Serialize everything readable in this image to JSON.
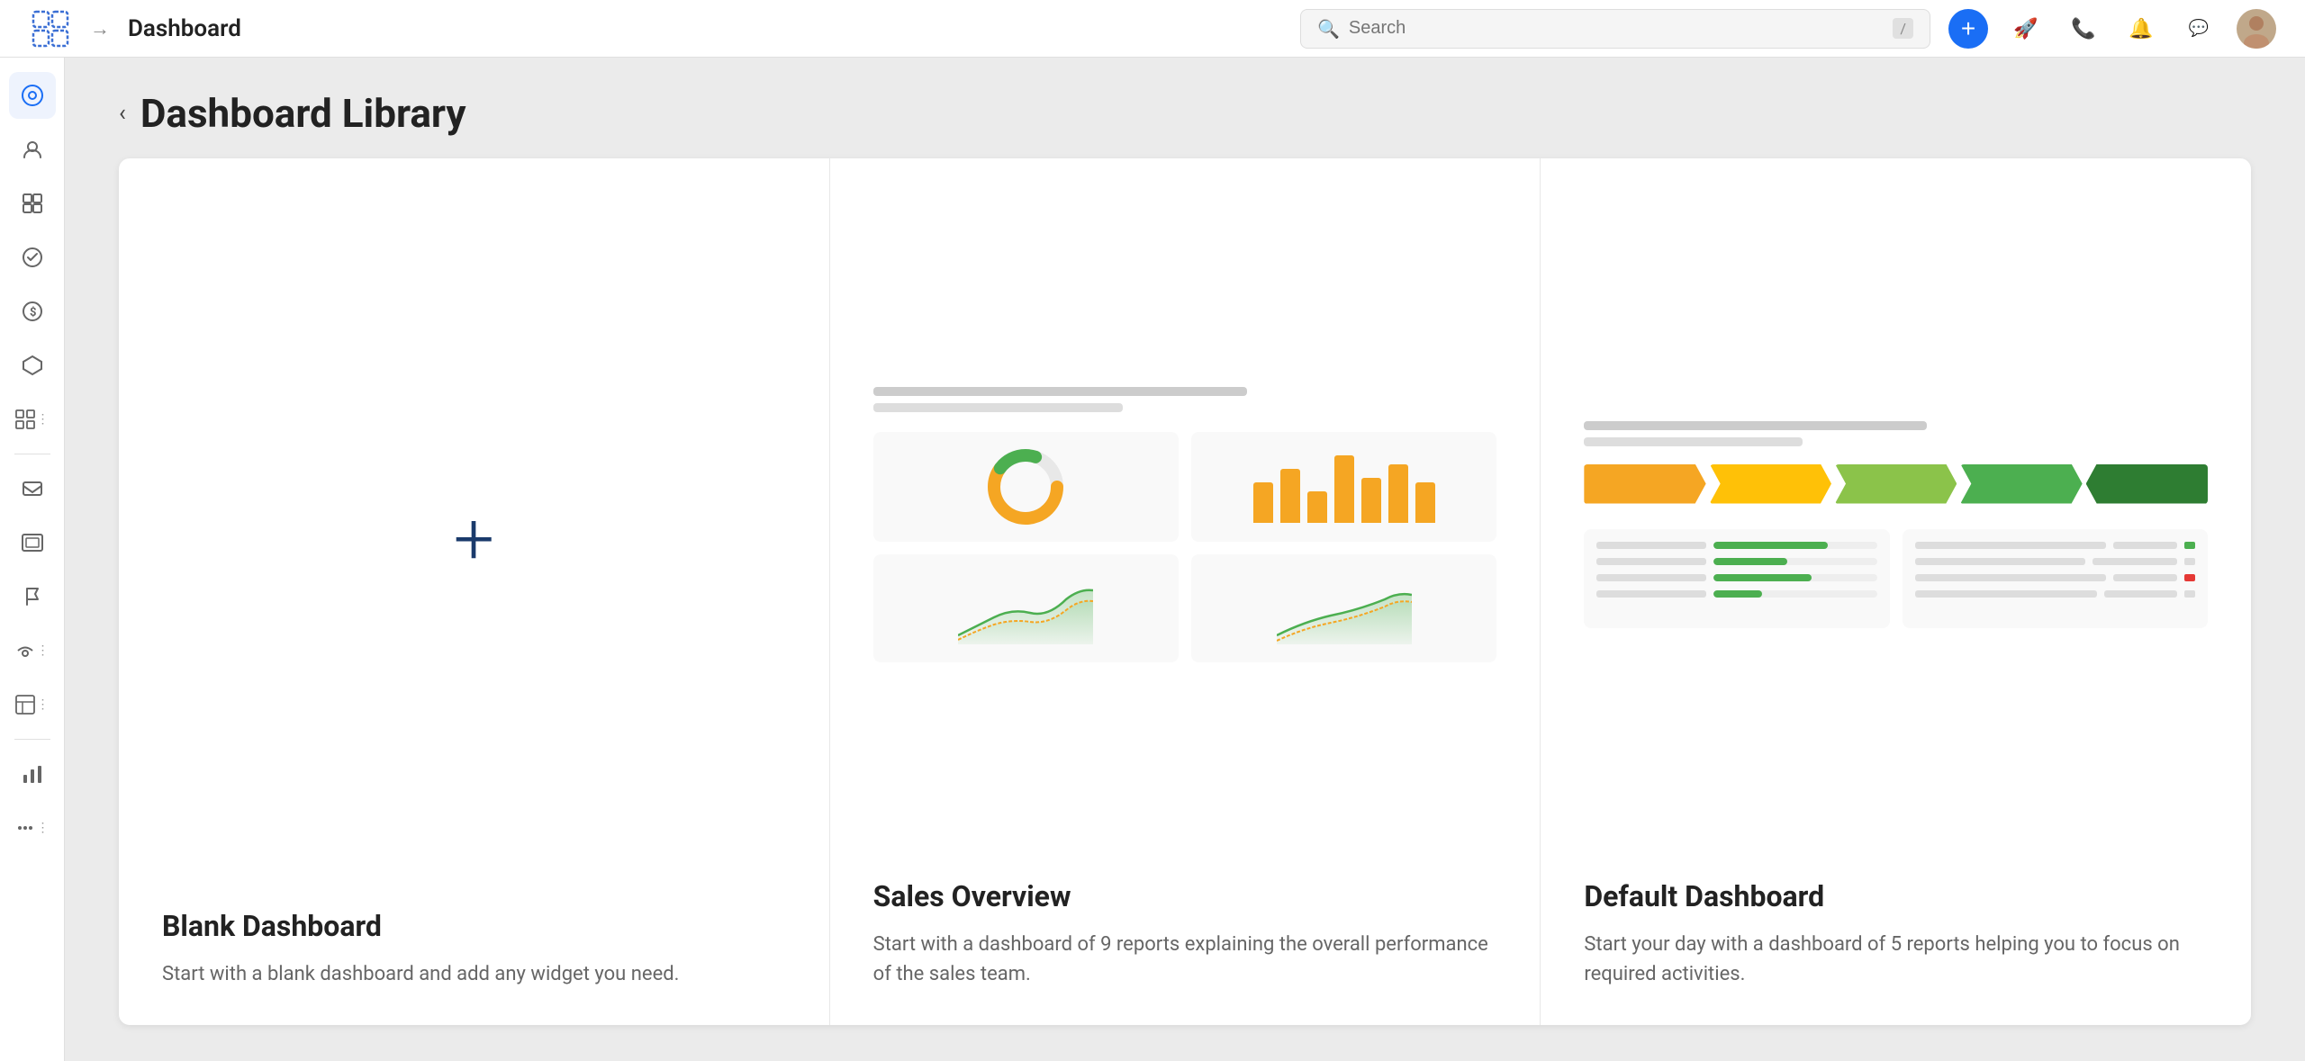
{
  "topbar": {
    "title": "Dashboard",
    "search_placeholder": "Search",
    "slash_label": "/",
    "add_label": "+",
    "logo_label": "app-logo"
  },
  "page": {
    "back_label": "‹",
    "title": "Dashboard Library"
  },
  "cards": [
    {
      "id": "blank",
      "title": "Blank Dashboard",
      "description": "Start with a blank dashboard and add any widget you need.",
      "icon": "+"
    },
    {
      "id": "sales",
      "title": "Sales Overview",
      "description": "Start with a dashboard of 9 reports explaining the overall performance of the sales team."
    },
    {
      "id": "default",
      "title": "Default Dashboard",
      "description": "Start your day with a dashboard of 5 reports helping you to focus on required activities."
    }
  ],
  "sidebar": {
    "items": [
      {
        "id": "home",
        "icon": "⊙",
        "label": "Home",
        "active": true
      },
      {
        "id": "contacts",
        "icon": "👤",
        "label": "Contacts"
      },
      {
        "id": "reports",
        "icon": "▦",
        "label": "Reports"
      },
      {
        "id": "tasks",
        "icon": "✓",
        "label": "Tasks"
      },
      {
        "id": "finance",
        "icon": "$",
        "label": "Finance"
      },
      {
        "id": "products",
        "icon": "⬡",
        "label": "Products"
      },
      {
        "id": "dashboards",
        "icon": "⊞",
        "label": "Dashboards",
        "has_dots": true
      },
      {
        "id": "inbox",
        "icon": "✉",
        "label": "Inbox"
      },
      {
        "id": "mail",
        "icon": "⊡",
        "label": "Mail"
      },
      {
        "id": "flag",
        "icon": "⚑",
        "label": "Flag"
      },
      {
        "id": "campaigns",
        "icon": "📢",
        "label": "Campaigns",
        "has_dots": true
      },
      {
        "id": "flows",
        "icon": "⊟",
        "label": "Flows",
        "has_dots": true
      },
      {
        "id": "analytics",
        "icon": "▐",
        "label": "Analytics"
      },
      {
        "id": "more",
        "icon": "…",
        "label": "More",
        "has_dots": true
      }
    ]
  },
  "colors": {
    "accent_blue": "#1a6ef5",
    "orange": "#f5a623",
    "green_light": "#4caf50",
    "green_dark": "#2e7d32",
    "yellow": "#ffc107",
    "teal": "#26a69a",
    "red": "#e53935"
  }
}
